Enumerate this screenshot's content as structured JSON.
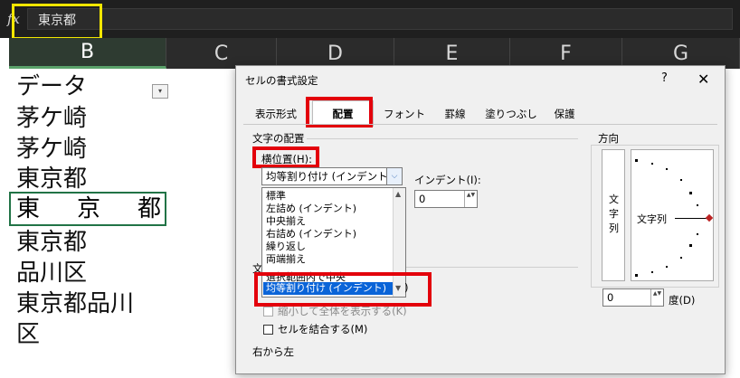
{
  "formula_bar": {
    "fx": "fx",
    "value": "東京都"
  },
  "columns": [
    "B",
    "C",
    "D",
    "E",
    "F",
    "G"
  ],
  "cells": {
    "header": "データ",
    "rows": [
      "茅ケ崎",
      "茅ケ崎",
      "東京都",
      "東京都",
      "品川区",
      "東京都品川",
      "区"
    ],
    "selected_chars": [
      "東",
      "京",
      "都"
    ],
    "filter_icon": "▾"
  },
  "dialog": {
    "title": "セルの書式設定",
    "help": "?",
    "close": "✕",
    "tabs": [
      "表示形式",
      "配置",
      "フォント",
      "罫線",
      "塗りつぶし",
      "保護"
    ],
    "active_tab": "配置",
    "text_alignment_label": "文字の配置",
    "horizontal_label": "横位置(H):",
    "horizontal_value": "均等割り付け (インデント)",
    "combo_arrow": "⌵",
    "options": [
      "標準",
      "左詰め (インデント)",
      "中央揃え",
      "右詰め (インデント)",
      "繰り返し",
      "両端揃え",
      "選択範囲内で中央",
      "均等割り付け (インデント)"
    ],
    "indent_label": "インデント(I):",
    "indent_value": "0",
    "text_control_label": "文",
    "shrink_label": "縮小して全体を表示する(K)",
    "merge_label": "セルを結合する(M)",
    "rtl_label": "右から左",
    "orientation_label": "方向",
    "vertical_text": [
      "文",
      "字",
      "列"
    ],
    "dial_text": "文字列",
    "degree_value": "0",
    "degree_label": "度(D)",
    "stray_paren": ")",
    "scroll_up": "▲",
    "scroll_down": "▼",
    "spin_arrows": "▲▼"
  }
}
